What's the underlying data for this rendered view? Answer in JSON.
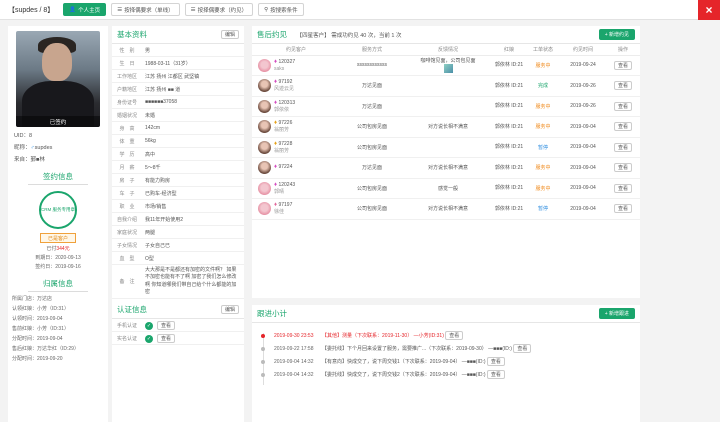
{
  "topbar": {
    "title": "【supdes / 8】",
    "buttons": [
      "个人主页",
      "按择偶要求（单线）",
      "按择偶要求（约见）",
      "按搜索条件"
    ],
    "close": "×"
  },
  "profile": {
    "status_badge": "已签约",
    "uid": "UID：8",
    "nickname_label": "昵称：",
    "nickname": "supdes",
    "source_label": "来自：",
    "source": "鄞■林",
    "sign_title": "签约信息",
    "stamp_text": "CRM 服务专用章",
    "member_tag": "已是客户",
    "paid_prefix": "已付",
    "paid_amount": "344元",
    "expire": "到期日：2020-09-13",
    "signed": "签约日：2019-09-16",
    "owner_title": "归属信息",
    "owner_lines": [
      "所属门店：万达店",
      "认领红娘：小芳（ID:31）",
      "认领时间：2019-09-04",
      "售前红娘：小芳（ID:31）",
      "分配时间：2019-09-04",
      "售后红娘：万达华红（ID:29）",
      "分配时间：2019-09-20"
    ]
  },
  "basic": {
    "title": "基本资料",
    "edit": "编辑",
    "rows": [
      {
        "k": "性　别",
        "v": "男"
      },
      {
        "k": "生　日",
        "v": "1988-03-11（31岁）"
      },
      {
        "k": "工作地区",
        "v": "江苏 扬州 江都区 武坚镇"
      },
      {
        "k": "户籍地区",
        "v": "江苏 扬州 ■■ 道"
      },
      {
        "k": "身份证号",
        "v": "■■■■■■37058"
      },
      {
        "k": "婚姻状况",
        "v": "未婚"
      },
      {
        "k": "身　高",
        "v": "142cm"
      },
      {
        "k": "体　重",
        "v": "56kg"
      },
      {
        "k": "学　历",
        "v": "高中"
      },
      {
        "k": "月　薪",
        "v": "5～8千"
      },
      {
        "k": "房　子",
        "v": "有能力购房"
      },
      {
        "k": "车　子",
        "v": "已购车-经济型"
      },
      {
        "k": "职　业",
        "v": "市场/销售"
      },
      {
        "k": "自我介绍",
        "v": "我11年开始使用2"
      },
      {
        "k": "家庭状况",
        "v": "两腿"
      },
      {
        "k": "子女情况",
        "v": "子女自己已"
      },
      {
        "k": "血　型",
        "v": "O型"
      },
      {
        "k": "备　注",
        "v": "大大那是不是都还有加密的文件啊？ 如果不加密也能有不了啊 加密了我们怎么修改啊 你知道哪我们带自己给个什么都能的加密"
      }
    ],
    "verify_title": "认证信息",
    "verify_edit": "编辑",
    "verify_rows": [
      {
        "k": "手机认证",
        "btn": "查看"
      },
      {
        "k": "实名认证",
        "btn": "查看"
      }
    ]
  },
  "meetings": {
    "title": "售后约见",
    "summary": "【四星客户】 需成功约见 40 次，当前 1 次",
    "add": "+ 新增约见",
    "headers": [
      "约见客户",
      "服务方式",
      "反馈情况",
      "红娘",
      "工单状态",
      "约见时间",
      "操作"
    ],
    "rows": [
      {
        "gem": "pink",
        "id": "120327",
        "name": "saks",
        "method": "ssssssssssss",
        "feedback": "咖啡馆见面，公司包见面",
        "matchmaker": "郭依林 ID:21",
        "status": "服务中",
        "status_color": "orange",
        "date": "2019-09-24",
        "op": "查看"
      },
      {
        "gem": "purple",
        "id": "97192",
        "name": "风迹云见",
        "method": "万达见面",
        "feedback": "",
        "matchmaker": "郭依林 ID:21",
        "status": "完成",
        "status_color": "green",
        "date": "2019-09-26",
        "op": "查看"
      },
      {
        "gem": "purple",
        "id": "120313",
        "name": "郭依依",
        "method": "万达见面",
        "feedback": "",
        "matchmaker": "郭依林 ID:21",
        "status": "服务中",
        "status_color": "orange",
        "date": "2019-09-26",
        "op": "查看"
      },
      {
        "gem": "gold",
        "id": "97226",
        "name": "翁丽芳",
        "method": "公司包房见面",
        "feedback": "对方说长相不满意",
        "matchmaker": "郭依林 ID:21",
        "status": "服务中",
        "status_color": "orange",
        "date": "2019-09-04",
        "op": "查看"
      },
      {
        "gem": "gold",
        "id": "97228",
        "name": "翁丽芳",
        "method": "公司包房见面",
        "feedback": "",
        "matchmaker": "郭依林 ID:21",
        "status": "暂停",
        "status_color": "blue",
        "date": "2019-09-04",
        "op": "查看"
      },
      {
        "gem": "purple",
        "id": "97224",
        "name": "",
        "method": "万达见面",
        "feedback": "对方说长相不满意",
        "matchmaker": "郭依林 ID:21",
        "status": "服务中",
        "status_color": "orange",
        "date": "2019-09-04",
        "op": "查看"
      },
      {
        "gem": "pink",
        "id": "120243",
        "name": "郭晴",
        "method": "公司包房见面",
        "feedback": "感觉一般",
        "matchmaker": "郭依林 ID:21",
        "status": "服务中",
        "status_color": "orange",
        "date": "2019-09-04",
        "op": "查看"
      },
      {
        "gem": "pinkish",
        "id": "97197",
        "name": "徐佳",
        "method": "公司包房见面",
        "feedback": "对方说长相不满意",
        "matchmaker": "郭依林 ID:21",
        "status": "暂停",
        "status_color": "blue",
        "date": "2019-09-04",
        "op": "查看"
      }
    ]
  },
  "followup": {
    "title": "跟进小计",
    "add": "+ 新增跟进",
    "rows": [
      {
        "date": "2019-09-30 23:53",
        "text": "【其他】测量（下次联系：2019-11-30） —小芳(ID:31)",
        "red": true,
        "op": "查看"
      },
      {
        "date": "2019-09-22 17:58",
        "text": "【委托线】下个月回来设置了服务，需要推广...（下次联系：2019-09-30） —■■■(ID:)",
        "red": false,
        "op": "查看"
      },
      {
        "date": "2019-09-04 14:32",
        "text": "【有意向】快成交了，说下周交钱1（下次联系：2019-09-04） —■■■(ID:)",
        "red": false,
        "op": "查看"
      },
      {
        "date": "2019-09-04 14:32",
        "text": "【委托线】快成交了，说下周交钱2（下次联系：2019-09-04） —■■■(ID:)",
        "red": false,
        "op": "查看"
      }
    ]
  },
  "colors": {
    "accent": "#1aa56c",
    "danger": "#e5252a",
    "orange": "#f08a1c",
    "blue": "#2f8ee0"
  }
}
